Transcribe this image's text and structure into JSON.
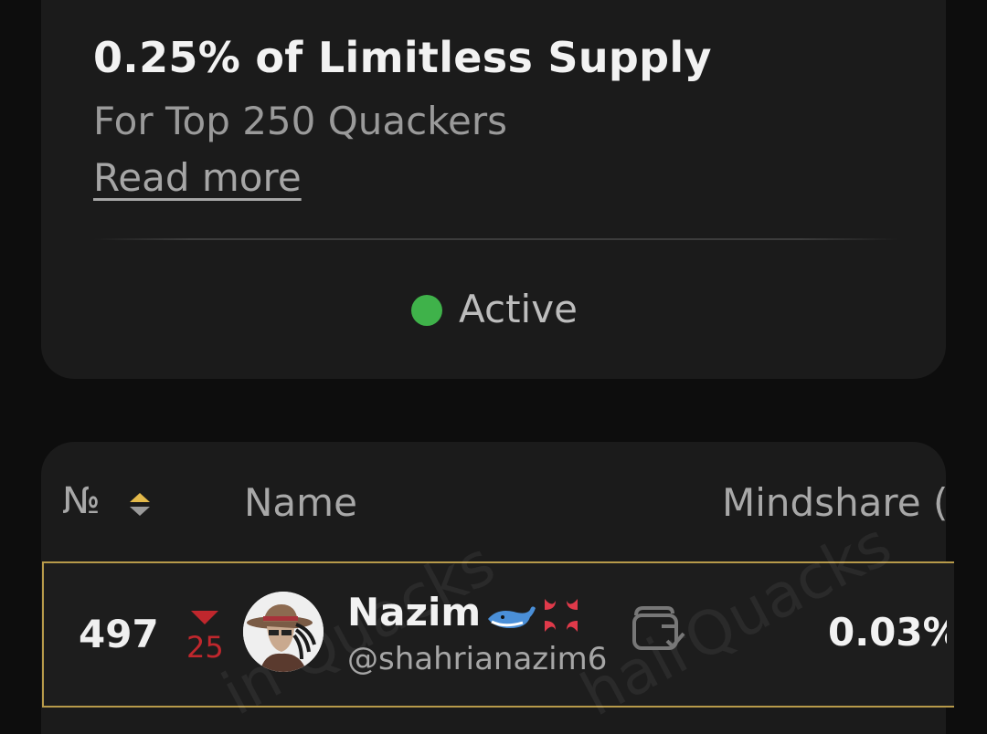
{
  "campaign": {
    "title": "0.25% of Limitless Supply",
    "subtitle": "For Top 250 Quackers",
    "read_more": "Read more",
    "status": "Active",
    "status_color": "#3fb24a"
  },
  "table": {
    "headers": {
      "rank": "№",
      "name": "Name",
      "mindshare": "Mindshare ("
    },
    "sort_icon": "sort-up-down-icon",
    "rows": [
      {
        "rank": "497",
        "change_direction": "down",
        "change": "25",
        "name": "Nazim",
        "badges": [
          "whale-emoji",
          "anger-symbol-emoji"
        ],
        "handle": "@shahrianazim6",
        "wallet_icon": "wallet-check-icon",
        "mindshare": "0.03%"
      }
    ],
    "watermark": "hairQuacks"
  },
  "colors": {
    "highlight_border": "#b79a4a",
    "down_red": "#c0272d",
    "sort_gold": "#e3b94a"
  }
}
